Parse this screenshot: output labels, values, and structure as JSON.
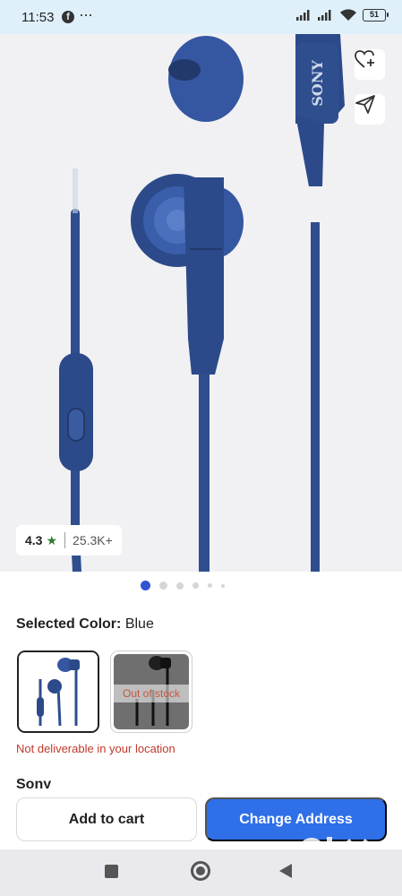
{
  "status_bar": {
    "time": "11:53",
    "app_icon": "facebook-icon",
    "more_icon": "more-dots-icon",
    "battery": "51"
  },
  "product_image": {
    "brand_mark": "SONY",
    "accent_color": "#2c4a8a",
    "background_color": "#f1f1f3"
  },
  "rating": {
    "value": "4.3",
    "star": "★",
    "count": "25.3K+"
  },
  "carousel": {
    "total": 6,
    "active_index": 0
  },
  "color_selector": {
    "label": "Selected Color:",
    "value": "Blue",
    "options": [
      {
        "name": "Blue",
        "selected": true,
        "status": ""
      },
      {
        "name": "Black",
        "selected": false,
        "status": "Out of stock"
      }
    ]
  },
  "delivery": {
    "message": "Not deliverable in your location",
    "color": "#c0392b"
  },
  "brand": {
    "name": "Sony"
  },
  "actions": {
    "add_to_cart": "Add to cart",
    "change_address": "Change Address",
    "primary_color": "#2f6fe8"
  },
  "watermark": {
    "text": "OLX"
  }
}
